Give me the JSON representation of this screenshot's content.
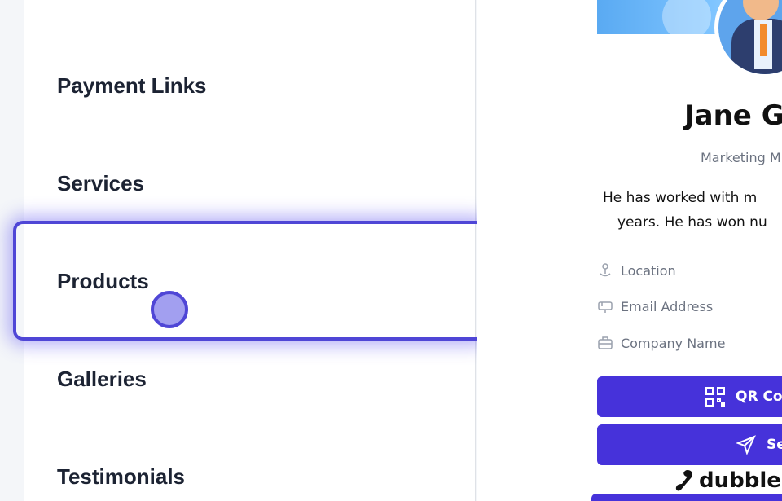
{
  "menu": {
    "items": [
      {
        "label": "Payment Links"
      },
      {
        "label": "Services"
      },
      {
        "label": "Products"
      },
      {
        "label": "Galleries"
      },
      {
        "label": "Testimonials"
      }
    ],
    "highlighted": "Products"
  },
  "preview": {
    "name": "Jane G",
    "job_title": "Marketing M",
    "bio_line1": "He has worked with m",
    "bio_line2": "years. He has won nu",
    "fields": {
      "location": "Location",
      "email": "Email Address",
      "company": "Company Name"
    },
    "buttons": {
      "qr": "QR Coc",
      "send": "Se"
    },
    "brand": "dubble"
  },
  "colors": {
    "accent": "#4632da",
    "highlight_border": "#4f46d6",
    "menu_text": "#1c2333"
  }
}
